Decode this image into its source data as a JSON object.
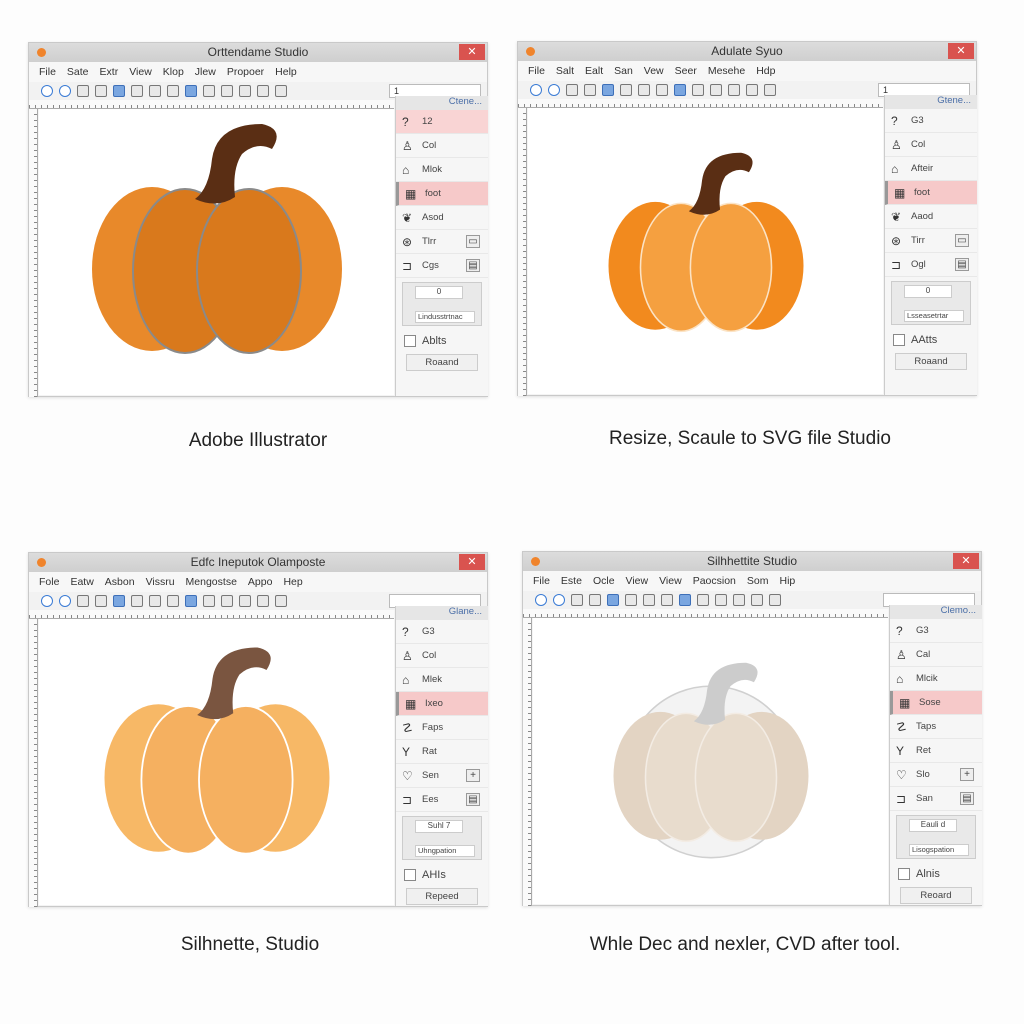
{
  "windows": [
    {
      "title": "Orttendame Studio",
      "menu": [
        "File",
        "Sate",
        "Extr",
        "View",
        "Klop",
        "Jlew",
        "Propoer",
        "Help"
      ],
      "combo": "1",
      "panel_header": "Ctene...",
      "top_row": [
        "?",
        "12"
      ],
      "top_pink": true,
      "items": [
        {
          "icon": "user-icon",
          "glyph": "♙",
          "label": "Col"
        },
        {
          "icon": "bell-icon",
          "glyph": "⌂",
          "label": "Mlok"
        },
        {
          "icon": "calendar-icon",
          "glyph": "▦",
          "label": "foot"
        },
        {
          "icon": "leaf-icon",
          "glyph": "❦",
          "label": "Asod"
        },
        {
          "icon": "wheel-icon",
          "glyph": "⊛",
          "label": "Tlrr",
          "side": "▭"
        },
        {
          "icon": "shape-icon",
          "glyph": "⊐",
          "label": "Cgs",
          "side": "▤"
        }
      ],
      "widget_value": "0",
      "widget_label": "Lindusstrtnac",
      "checkbox": "Ablts",
      "button": "Roaand",
      "caption": "Adobe Illustrator",
      "colors": {
        "body": "#e8892a",
        "rib": "#d9791c",
        "stem": "#5a2e14",
        "line": "#8a8a8a"
      }
    },
    {
      "title": "Adulate Syuo",
      "menu": [
        "File",
        "Salt",
        "Ealt",
        "San",
        "Vew",
        "Seer",
        "Mesehe",
        "Hdp"
      ],
      "combo": "1",
      "panel_header": "Gtene...",
      "top_row": [
        "?",
        "G3"
      ],
      "top_pink": false,
      "items": [
        {
          "icon": "user-icon",
          "glyph": "♙",
          "label": "Col"
        },
        {
          "icon": "bell-icon",
          "glyph": "⌂",
          "label": "Afteir"
        },
        {
          "icon": "calendar-icon",
          "glyph": "▦",
          "label": "foot"
        },
        {
          "icon": "leaf-icon",
          "glyph": "❦",
          "label": "Aaod"
        },
        {
          "icon": "wheel-icon",
          "glyph": "⊛",
          "label": "Tirr",
          "side": "▭"
        },
        {
          "icon": "shape-icon",
          "glyph": "⊐",
          "label": "Ogl",
          "side": "▤"
        }
      ],
      "widget_value": "0",
      "widget_label": "Lsseasetrtar",
      "checkbox": "AAtts",
      "button": "Roaand",
      "caption": "Resize, Scaule to SVG file Studio",
      "colors": {
        "body": "#f28a1e",
        "rib": "#f5a040",
        "stem": "#5a2e14",
        "line": "#fbe3c5"
      }
    },
    {
      "title": "Edfc Ineputok Olamposte",
      "menu": [
        "Fole",
        "Eatw",
        "Asbon",
        "Vissru",
        "Mengostse",
        "Appo",
        "Hep"
      ],
      "combo": "",
      "panel_header": "Glane...",
      "top_row": [
        "?",
        "G3"
      ],
      "top_pink": false,
      "items": [
        {
          "icon": "user-icon",
          "glyph": "♙",
          "label": "Col"
        },
        {
          "icon": "home-icon",
          "glyph": "⌂",
          "label": "Mlek"
        },
        {
          "icon": "calendar-icon",
          "glyph": "▦",
          "label": "Ixeo"
        },
        {
          "icon": "path-icon",
          "glyph": "☡",
          "label": "Faps"
        },
        {
          "icon": "branch-icon",
          "glyph": "Y",
          "label": "Rat"
        },
        {
          "icon": "heart-icon",
          "glyph": "♡",
          "label": "Sen",
          "side": "+"
        },
        {
          "icon": "shape-icon",
          "glyph": "⊐",
          "label": "Ees",
          "side": "▤"
        }
      ],
      "widget_value": "Suhl 7",
      "widget_label": "Uhngpation",
      "checkbox": "AHIs",
      "button": "Repeed",
      "caption": "Silhnette, Studio",
      "colors": {
        "body": "#f7b866",
        "rib": "#f5b060",
        "stem": "#7a5540",
        "line": "#ffffff"
      }
    },
    {
      "title": "Silhhettite Studio",
      "menu": [
        "File",
        "Este",
        "Ocle",
        "View",
        "View",
        "Paocsion",
        "Som",
        "Hip"
      ],
      "combo": "",
      "panel_header": "Clemo...",
      "top_row": [
        "?",
        "G3"
      ],
      "top_pink": false,
      "items": [
        {
          "icon": "user-icon",
          "glyph": "♙",
          "label": "Cal"
        },
        {
          "icon": "bell-icon",
          "glyph": "⌂",
          "label": "Mlcik"
        },
        {
          "icon": "calendar-icon",
          "glyph": "▦",
          "label": "Sose"
        },
        {
          "icon": "path-icon",
          "glyph": "☡",
          "label": "Taps"
        },
        {
          "icon": "branch-icon",
          "glyph": "Y",
          "label": "Ret"
        },
        {
          "icon": "heart-icon",
          "glyph": "♡",
          "label": "Slo",
          "side": "+"
        },
        {
          "icon": "shape-icon",
          "glyph": "⊐",
          "label": "San",
          "side": "▤"
        }
      ],
      "widget_value": "Eauli d",
      "widget_label": "Lisogspation",
      "checkbox": "Alnis",
      "button": "Reoard",
      "caption": "Whle Dec and nexler, CVD after tool.",
      "colors": {
        "body": "#e3d4c3",
        "rib": "#e8dccd",
        "stem": "#cccccc",
        "line": "#f3ece4",
        "ring": "#d0d0d0"
      }
    }
  ]
}
